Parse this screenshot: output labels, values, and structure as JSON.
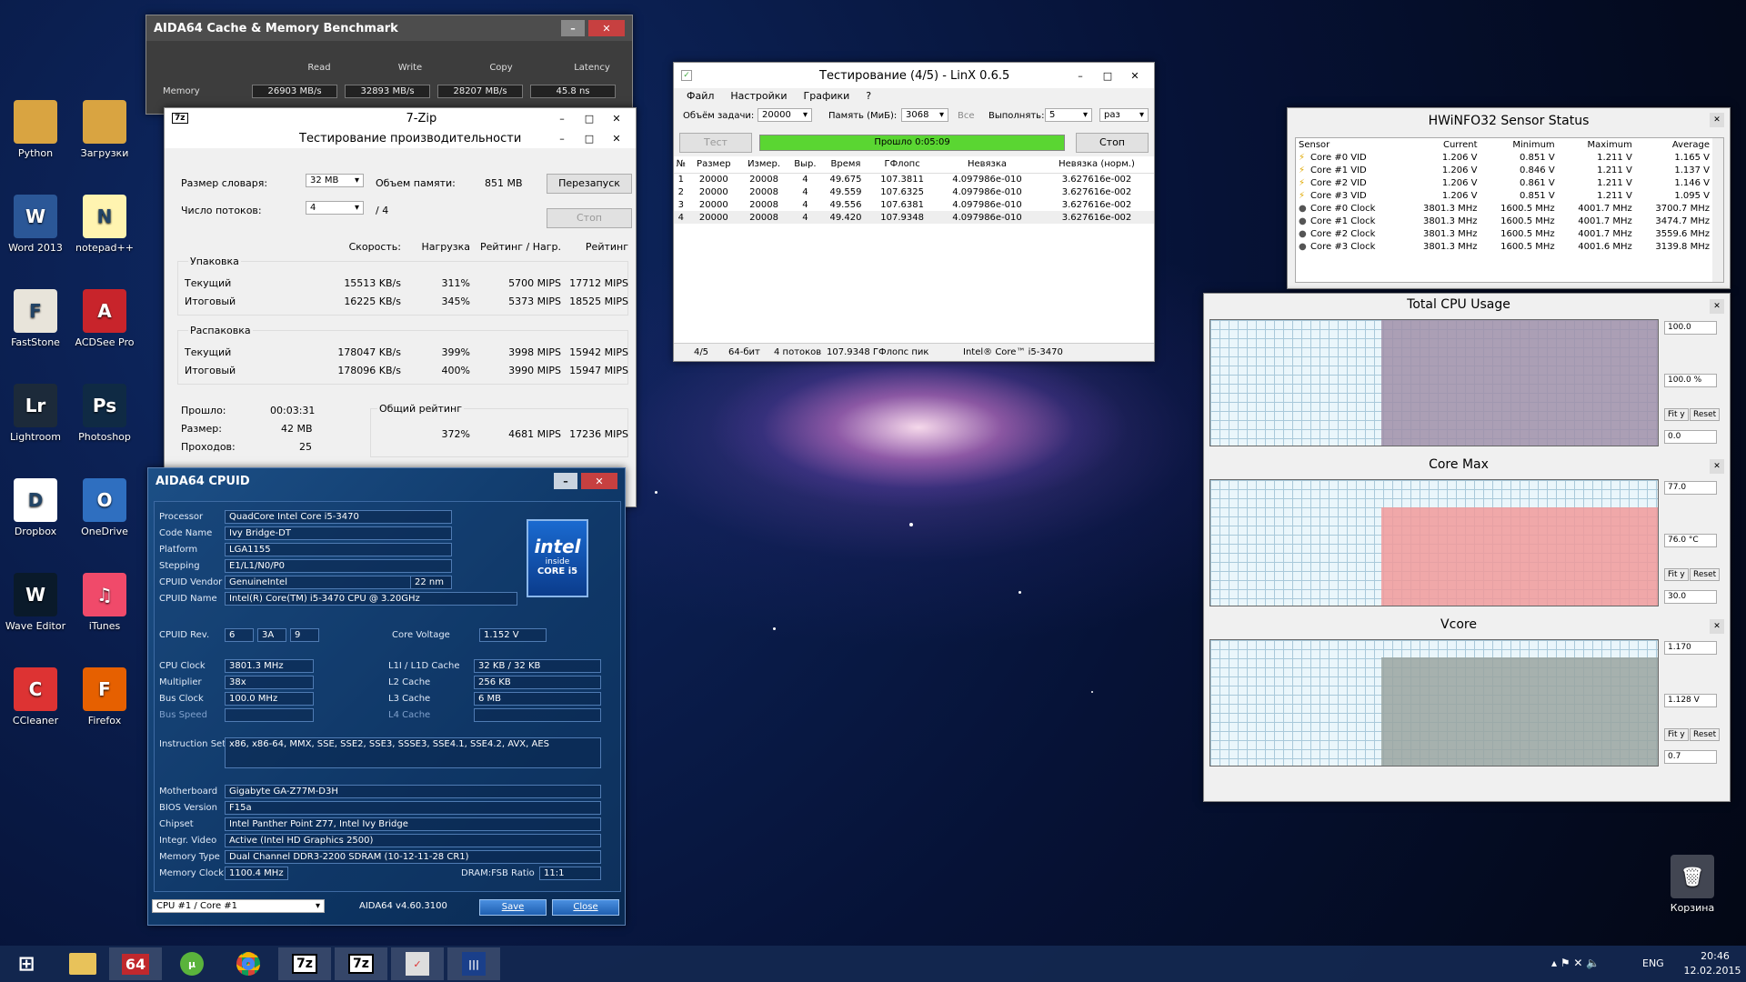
{
  "desktop": {
    "icons": [
      {
        "label": "Python",
        "color": "#d9a441",
        "glyph": "folder-icon"
      },
      {
        "label": "Загрузки",
        "color": "#d9a441",
        "glyph": "folder-icon"
      },
      {
        "label": "Word 2013",
        "color": "#2b5797",
        "glyph": "W"
      },
      {
        "label": "notepad++",
        "color": "#fff4b0",
        "glyph": "N"
      },
      {
        "label": "FastStone",
        "color": "#e8e4da",
        "glyph": "F"
      },
      {
        "label": "ACDSee Pro",
        "color": "#c8242b",
        "glyph": "A"
      },
      {
        "label": "Lightroom",
        "color": "#1c2a3a",
        "glyph": "Lr"
      },
      {
        "label": "Photoshop",
        "color": "#0f2a44",
        "glyph": "Ps"
      },
      {
        "label": "Dropbox",
        "color": "#ffffff",
        "glyph": "D"
      },
      {
        "label": "OneDrive",
        "color": "#2f6fc0",
        "glyph": "O"
      },
      {
        "label": "Wave Editor",
        "color": "#0a1a2a",
        "glyph": "W"
      },
      {
        "label": "iTunes",
        "color": "#f04a6a",
        "glyph": "♫"
      },
      {
        "label": "CCleaner",
        "color": "#d33",
        "glyph": "C"
      },
      {
        "label": "Firefox",
        "color": "#e66000",
        "glyph": "F"
      }
    ],
    "recycle": "Корзина"
  },
  "aida_cache": {
    "title": "AIDA64 Cache & Memory Benchmark",
    "cols": [
      "Read",
      "Write",
      "Copy",
      "Latency"
    ],
    "row_label": "Memory",
    "values": [
      "26903 MB/s",
      "32893 MB/s",
      "28207 MB/s",
      "45.8 ns"
    ]
  },
  "zip": {
    "title": "7-Zip",
    "subtitle": "Тестирование производительности",
    "dict_label": "Размер словаря:",
    "dict": "32 MB",
    "mem_label": "Объем памяти:",
    "mem": "851 MB",
    "threads_label": "Число потоков:",
    "threads": "4",
    "threads_of": "/ 4",
    "restart": "Перезапуск",
    "stop": "Стоп",
    "headers": [
      "Скорость:",
      "Нагрузка",
      "Рейтинг / Нагр.",
      "Рейтинг"
    ],
    "pack": "Упаковка",
    "unpack": "Распаковка",
    "pack_rows": [
      [
        "Текущий",
        "15513 KB/s",
        "311%",
        "5700 MIPS",
        "17712 MIPS"
      ],
      [
        "Итоговый",
        "16225 KB/s",
        "345%",
        "5373 MIPS",
        "18525 MIPS"
      ]
    ],
    "unpack_rows": [
      [
        "Текущий",
        "178047 KB/s",
        "399%",
        "3998 MIPS",
        "15942 MIPS"
      ],
      [
        "Итоговый",
        "178096 KB/s",
        "400%",
        "3990 MIPS",
        "15947 MIPS"
      ]
    ],
    "elapsed_label": "Прошло:",
    "elapsed": "00:03:31",
    "size_label": "Размер:",
    "size": "42 MB",
    "passes_label": "Проходов:",
    "passes": "25",
    "total_label": "Общий рейтинг",
    "total": [
      "372%",
      "4681 MIPS",
      "17236 MIPS"
    ]
  },
  "cpuid": {
    "title": "AIDA64 CPUID",
    "rows1": [
      [
        "Processor",
        "QuadCore Intel Core i5-3470"
      ],
      [
        "Code Name",
        "Ivy Bridge-DT"
      ],
      [
        "Platform",
        "LGA1155"
      ],
      [
        "Stepping",
        "E1/L1/N0/P0"
      ],
      [
        "CPUID Vendor",
        "GenuineIntel"
      ],
      [
        "CPUID Name",
        "Intel(R) Core(TM) i5-3470 CPU @ 3.20GHz"
      ]
    ],
    "nm": "22 nm",
    "rev_label": "CPUID Rev.",
    "rev": [
      "6",
      "3A",
      "9"
    ],
    "vcore_label": "Core Voltage",
    "vcore": "1.152 V",
    "clk": [
      [
        "CPU Clock",
        "3801.3 MHz"
      ],
      [
        "Multiplier",
        "38x"
      ],
      [
        "Bus Clock",
        "100.0 MHz"
      ],
      [
        "Bus Speed",
        ""
      ]
    ],
    "cache": [
      [
        "L1I / L1D Cache",
        "32 KB / 32 KB"
      ],
      [
        "L2 Cache",
        "256 KB"
      ],
      [
        "L3 Cache",
        "6 MB"
      ],
      [
        "L4 Cache",
        ""
      ]
    ],
    "iset_label": "Instruction Set",
    "iset": "x86, x86-64, MMX, SSE, SSE2, SSE3, SSSE3, SSE4.1, SSE4.2, AVX, AES",
    "rows2": [
      [
        "Motherboard",
        "Gigabyte GA-Z77M-D3H"
      ],
      [
        "BIOS Version",
        "F15a"
      ],
      [
        "Chipset",
        "Intel Panther Point Z77, Intel Ivy Bridge"
      ],
      [
        "Integr. Video",
        "Active  (Intel HD Graphics 2500)"
      ],
      [
        "Memory Type",
        "Dual Channel DDR3-2200 SDRAM  (10-12-11-28 CR1)"
      ],
      [
        "Memory Clock",
        "1100.4 MHz"
      ]
    ],
    "ratio_label": "DRAM:FSB Ratio",
    "ratio": "11:1",
    "core_select": "CPU #1 / Core #1",
    "version": "AIDA64 v4.60.3100",
    "save": "Save",
    "close": "Close",
    "badge": [
      "intel",
      "inside",
      "CORE i5"
    ]
  },
  "linx": {
    "title": "Тестирование (4/5) - LinX 0.6.5",
    "menu": [
      "Файл",
      "Настройки",
      "Графики",
      "?"
    ],
    "size_label": "Объём задачи:",
    "size": "20000",
    "mem_label": "Память (МиБ):",
    "mem": "3068",
    "all": "Все",
    "run_label": "Выполнять:",
    "run": "5",
    "times": "раз",
    "test": "Тест",
    "progress_text": "Прошло 0:05:09",
    "progress": 1.0,
    "stop": "Стоп",
    "headers": [
      "№",
      "Размер",
      "Измер.",
      "Выр.",
      "Время",
      "ГФлопс",
      "Невязка",
      "Невязка (норм.)"
    ],
    "rows": [
      [
        "1",
        "20000",
        "20008",
        "4",
        "49.675",
        "107.3811",
        "4.097986e-010",
        "3.627616e-002"
      ],
      [
        "2",
        "20000",
        "20008",
        "4",
        "49.559",
        "107.6325",
        "4.097986e-010",
        "3.627616e-002"
      ],
      [
        "3",
        "20000",
        "20008",
        "4",
        "49.556",
        "107.6381",
        "4.097986e-010",
        "3.627616e-002"
      ],
      [
        "4",
        "20000",
        "20008",
        "4",
        "49.420",
        "107.9348",
        "4.097986e-010",
        "3.627616e-002"
      ]
    ],
    "status": [
      "4/5",
      "64-бит",
      "4 потоков",
      "107.9348 ГФлопс пик",
      "Intel® Core™ i5-3470"
    ]
  },
  "hwinfo": {
    "title": "HWiNFO32 Sensor Status",
    "headers": [
      "Sensor",
      "Current",
      "Minimum",
      "Maximum",
      "Average"
    ],
    "rows": [
      [
        "Core #0 VID",
        "1.206 V",
        "0.851 V",
        "1.211 V",
        "1.165 V"
      ],
      [
        "Core #1 VID",
        "1.206 V",
        "0.846 V",
        "1.211 V",
        "1.137 V"
      ],
      [
        "Core #2 VID",
        "1.206 V",
        "0.861 V",
        "1.211 V",
        "1.146 V"
      ],
      [
        "Core #3 VID",
        "1.206 V",
        "0.851 V",
        "1.211 V",
        "1.095 V"
      ],
      [
        "Core #0 Clock",
        "3801.3 MHz",
        "1600.5 MHz",
        "4001.7 MHz",
        "3700.7 MHz"
      ],
      [
        "Core #1 Clock",
        "3801.3 MHz",
        "1600.5 MHz",
        "4001.7 MHz",
        "3474.7 MHz"
      ],
      [
        "Core #2 Clock",
        "3801.3 MHz",
        "1600.5 MHz",
        "4001.7 MHz",
        "3559.6 MHz"
      ],
      [
        "Core #3 Clock",
        "3801.3 MHz",
        "1600.5 MHz",
        "4001.6 MHz",
        "3139.8 MHz"
      ]
    ],
    "graphs": [
      {
        "title": "Total CPU Usage",
        "max": "100.0",
        "cur": "100.0 %",
        "min": "0.0",
        "fill": "#a08fa8"
      },
      {
        "title": "Core Max",
        "max": "77.0",
        "cur": "76.0 °C",
        "min": "30.0",
        "fill": "#f19a9a"
      },
      {
        "title": "Vcore",
        "max": "1.170",
        "cur": "1.128 V",
        "min": "0.7",
        "fill": "#9aa5a0"
      }
    ],
    "fity": "Fit y",
    "reset": "Reset"
  },
  "taskbar": {
    "apps": [
      "64",
      "7z",
      "7z"
    ],
    "lang": "ENG",
    "time": "20:46",
    "date": "12.02.2015"
  }
}
